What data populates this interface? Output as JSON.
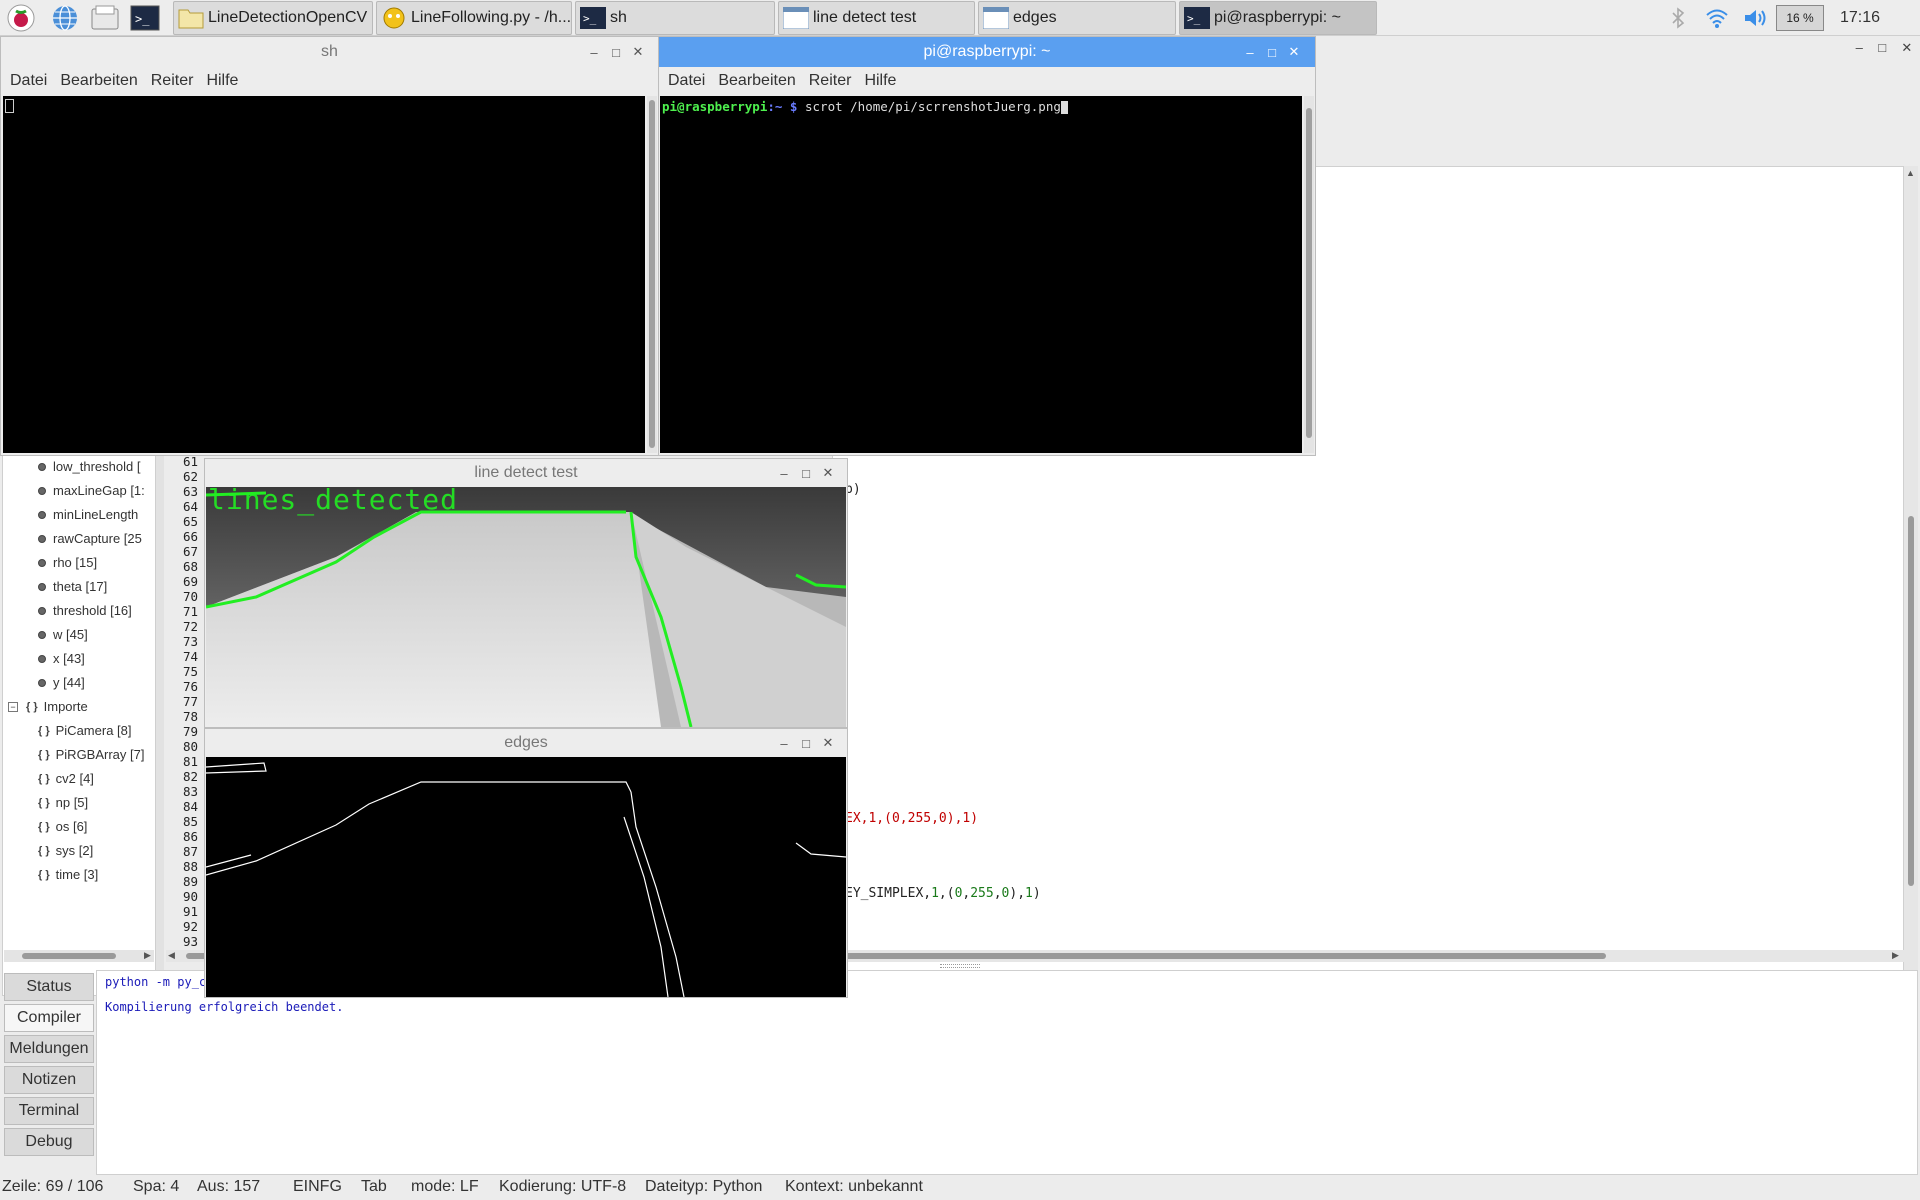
{
  "taskbar": {
    "launchers": [
      "raspberry-menu-icon",
      "web-browser-icon",
      "file-manager-icon",
      "terminal-icon"
    ],
    "tasks": [
      "LineDetectionOpenCV",
      "LineFollowing.py - /h...",
      "sh",
      "line detect test",
      "edges",
      "pi@raspberrypi: ~"
    ],
    "cpu": "16 %",
    "clock": "17:16"
  },
  "sh_window": {
    "title": "sh",
    "menu": [
      "Datei",
      "Bearbeiten",
      "Reiter",
      "Hilfe"
    ]
  },
  "pi_window": {
    "title": "pi@raspberrypi: ~",
    "menu": [
      "Datei",
      "Bearbeiten",
      "Reiter",
      "Hilfe"
    ],
    "prompt_user": "pi@raspberrypi",
    "prompt_rest": ":~ $",
    "command": " scrot /home/pi/scrrenshotJuerg.png"
  },
  "symbols": {
    "variables": [
      "low_threshold [",
      "maxLineGap [1:",
      "minLineLength",
      "rawCapture [25",
      "rho [15]",
      "theta [17]",
      "threshold [16]",
      "w [45]",
      "x [43]",
      "y [44]"
    ],
    "imports_label": "Importe",
    "imports": [
      "PiCamera [8]",
      "PiRGBArray [7]",
      "cv2 [4]",
      "np [5]",
      "os [6]",
      "sys [2]",
      "time [3]"
    ]
  },
  "editor": {
    "line_numbers": [
      "61",
      "62",
      "63",
      "64",
      "65",
      "66",
      "67",
      "68",
      "69",
      "70",
      "71",
      "72",
      "73",
      "74",
      "75",
      "76",
      "77",
      "78",
      "79",
      "80",
      "81",
      "82",
      "83",
      "84",
      "85",
      "86",
      "87",
      "88",
      "89",
      "90",
      "91",
      "92",
      "93"
    ],
    "frag_paren": "p)",
    "frag_85": "EX,1,(0,255,0),1)",
    "frag_90_a": "EY_SIMPLEX,",
    "frag_90_b": "1",
    "frag_90_c": ",(",
    "frag_90_d": "0",
    "frag_90_e": ",",
    "frag_90_f": "255",
    "frag_90_g": ",",
    "frag_90_h": "0",
    "frag_90_i": "),",
    "frag_90_j": "1",
    "frag_90_k": ")"
  },
  "line_detect_window": {
    "title": "line detect test",
    "overlay_text": "lines_detected"
  },
  "edges_window": {
    "title": "edges"
  },
  "messages": {
    "tabs": [
      "Status",
      "Compiler",
      "Meldungen",
      "Notizen",
      "Terminal",
      "Debug"
    ],
    "selected_tab": "Compiler",
    "command": "python -m py_c",
    "result": "Kompilierung erfolgreich beendet."
  },
  "statusbar": {
    "line": "Zeile: 69 / 106",
    "col": "Spa: 4",
    "sel": "Aus: 157",
    "mode_ins": "EINFG",
    "indent": "Tab",
    "eol": "mode: LF",
    "encoding": "Kodierung: UTF-8",
    "filetype": "Dateityp: Python",
    "context": "Kontext: unbekannt"
  },
  "colors": {
    "accent": "#5a9ff0",
    "detected_line": "#22ee22",
    "prompt_green": "#4ef04e",
    "prompt_blue": "#6a7cff",
    "code_red": "#c00000"
  }
}
